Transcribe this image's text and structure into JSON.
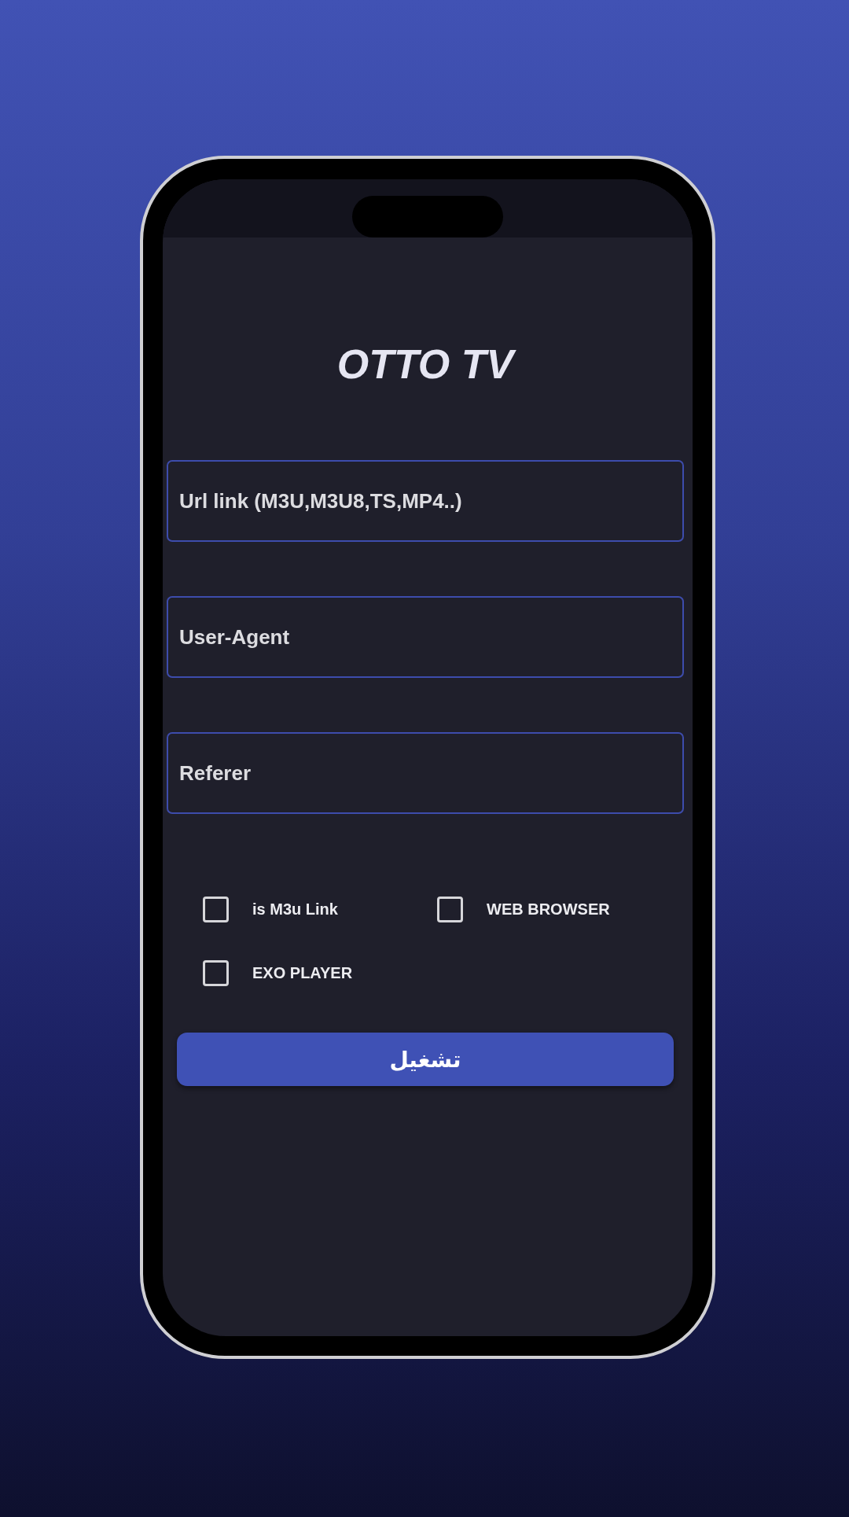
{
  "app": {
    "title": "OTTO TV"
  },
  "fields": [
    {
      "placeholder": "Url link (M3U,M3U8,TS,MP4..)"
    },
    {
      "placeholder": "User-Agent"
    },
    {
      "placeholder": "Referer"
    }
  ],
  "options": [
    {
      "label": "is M3u Link",
      "checked": false
    },
    {
      "label": "WEB BROWSER",
      "checked": false
    },
    {
      "label": "EXO PLAYER",
      "checked": false
    }
  ],
  "play_button": {
    "label": "تشغيل"
  }
}
